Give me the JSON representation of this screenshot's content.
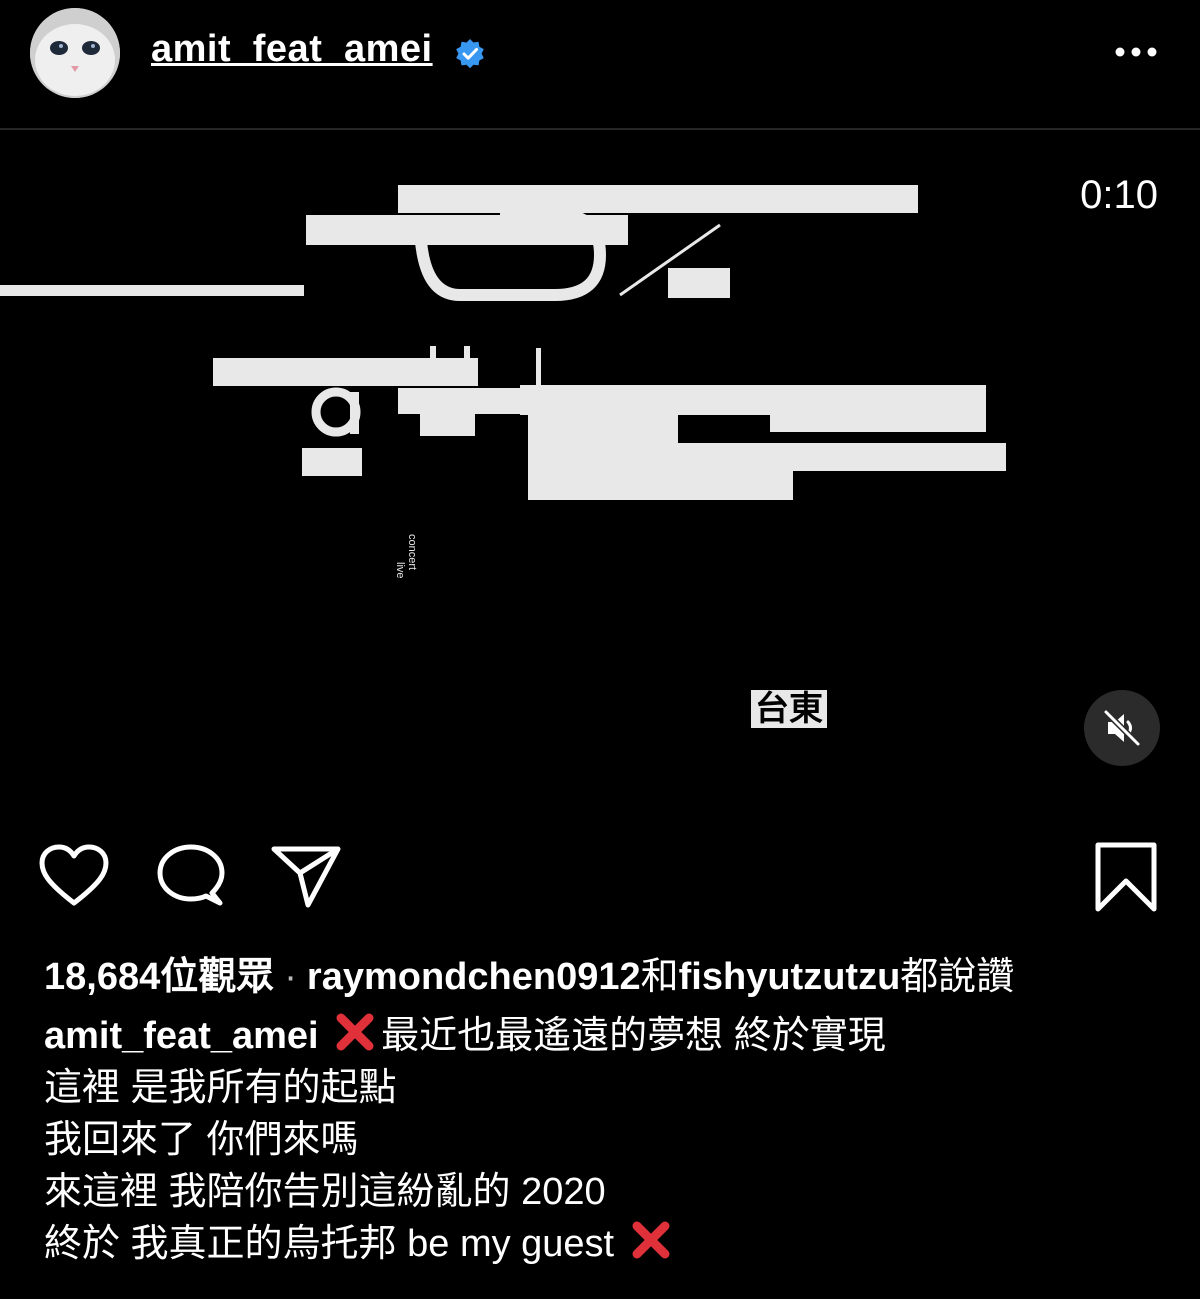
{
  "header": {
    "username": "amit_feat_amei",
    "verified_icon": "verified-badge-icon",
    "more_icon": "more-options-icon"
  },
  "media": {
    "timer": "0:10",
    "mute_icon": "speaker-muted-icon",
    "artwork_text": {
      "live": "live",
      "concert": "concert",
      "city": "台東"
    }
  },
  "actions": {
    "like_icon": "heart-icon",
    "comment_icon": "comment-bubble-icon",
    "share_icon": "paper-plane-icon",
    "save_icon": "bookmark-icon"
  },
  "stats": {
    "views": "18,684",
    "views_label": "位觀眾",
    "separator": "·",
    "liker1": "raymondchen0912",
    "and": "和",
    "liker2": "fishyutzutzu",
    "liked_suffix": "都說讚"
  },
  "caption": {
    "username": "amit_feat_amei",
    "line1": "最近也最遙遠的夢想 終於實現",
    "line2": "這裡 是我所有的起點",
    "line3": "我回來了 你們來嗎",
    "line4": "來這裡 我陪你告別這紛亂的 2020",
    "line5": "終於 我真正的烏托邦 be my guest",
    "emoji_icon": "red-x-emoji-icon"
  },
  "colors": {
    "background": "#000000",
    "verified": "#3897f0",
    "red_x": "#e0303a",
    "artwork": "#e8e8e8"
  }
}
